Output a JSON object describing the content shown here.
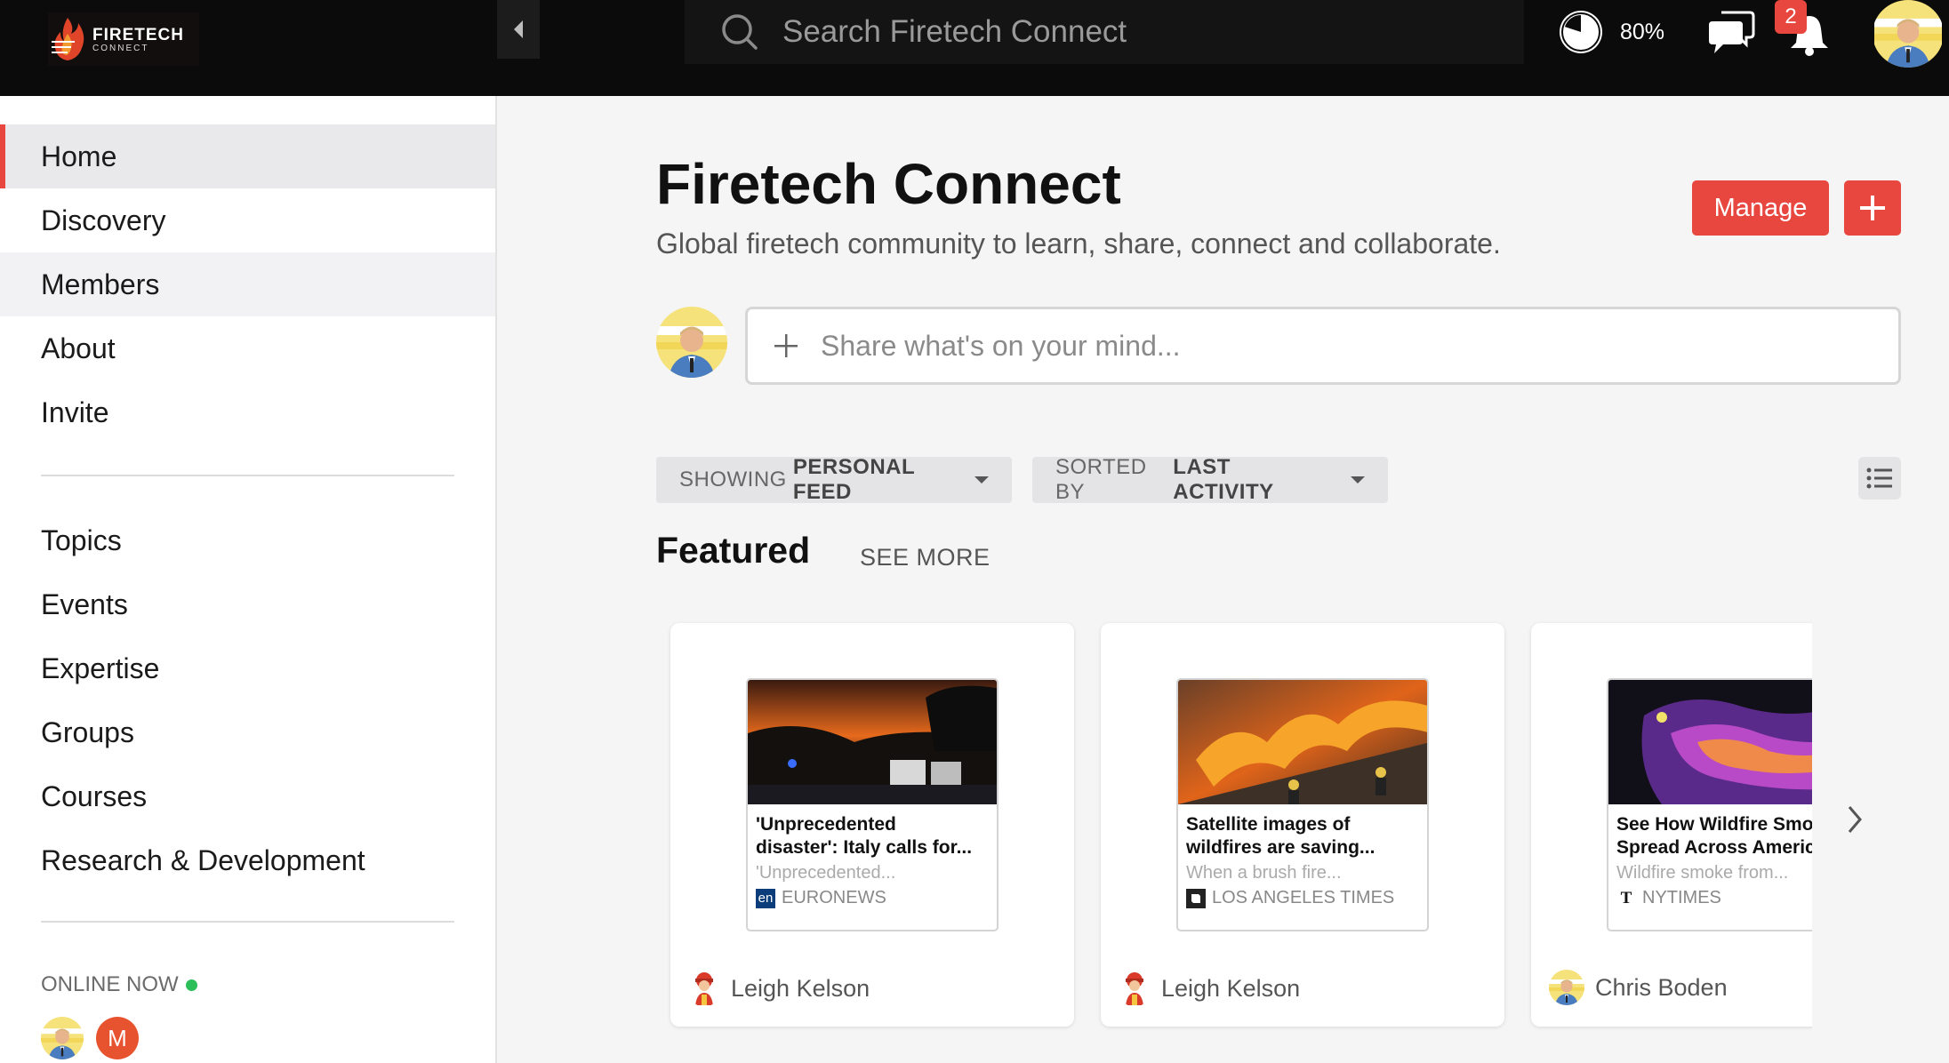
{
  "brand": {
    "logo_line1": "FIRETECH",
    "logo_line2": "CONNECT"
  },
  "topbar": {
    "search_placeholder": "Search Firetech Connect",
    "progress_label": "80%",
    "progress_value": 0.8,
    "notification_count": "2"
  },
  "sidebar": {
    "items": [
      {
        "label": "Home"
      },
      {
        "label": "Discovery"
      },
      {
        "label": "Members"
      },
      {
        "label": "About"
      },
      {
        "label": "Invite"
      }
    ],
    "secondary_items": [
      {
        "label": "Topics"
      },
      {
        "label": "Events"
      },
      {
        "label": "Expertise"
      },
      {
        "label": "Groups"
      },
      {
        "label": "Courses"
      },
      {
        "label": "Research & Development"
      }
    ],
    "online_label": "ONLINE NOW",
    "online_initial": "M"
  },
  "main": {
    "title": "Firetech Connect",
    "subtitle": "Global firetech community to learn, share, connect and collaborate.",
    "manage_label": "Manage",
    "composer_placeholder": "Share what's on your mind...",
    "filter1": {
      "prefix": "SHOWING",
      "value": "PERSONAL FEED"
    },
    "filter2": {
      "prefix": "SORTED BY",
      "value": "LAST ACTIVITY"
    },
    "featured_label": "Featured",
    "see_more_label": "SEE MORE"
  },
  "cards": [
    {
      "title": "'Unprecedented\ndisaster': Italy calls for...",
      "desc": "'Unprecedented...",
      "source_badge": "en",
      "source": "EURONEWS",
      "author": "Leigh Kelson"
    },
    {
      "title": "Satellite images of\nwildfires are saving...",
      "desc": "When a brush fire...",
      "source_badge": "",
      "source": "LOS ANGELES TIMES",
      "author": "Leigh Kelson"
    },
    {
      "title": "See How Wildfire Smoke\nSpread Across America",
      "desc": "Wildfire smoke from...",
      "source_badge": "T",
      "source": "NYTIMES",
      "author": "Chris Boden"
    }
  ],
  "colors": {
    "accent": "#e8473f",
    "online": "#2dbf5a",
    "topbar": "#0b0b0b"
  }
}
